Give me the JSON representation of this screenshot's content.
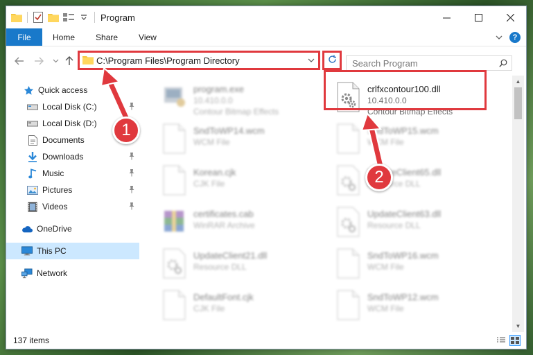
{
  "window": {
    "title": "Program",
    "accent_color": "#1979ca",
    "highlight_color": "#e0393e"
  },
  "ribbon": {
    "tabs": [
      "File",
      "Home",
      "Share",
      "View"
    ]
  },
  "address": {
    "path": "C:\\Program Files\\Program Directory",
    "search_placeholder": "Search Program"
  },
  "sidebar": {
    "items": [
      {
        "label": "Quick access",
        "icon": "star-icon",
        "pinned": false
      },
      {
        "label": "Local Disk (C:)",
        "icon": "drive-icon",
        "pinned": true
      },
      {
        "label": "Local Disk (D:)",
        "icon": "drive-icon",
        "pinned": true
      },
      {
        "label": "Documents",
        "icon": "documents-icon",
        "pinned": true
      },
      {
        "label": "Downloads",
        "icon": "download-icon",
        "pinned": true
      },
      {
        "label": "Music",
        "icon": "music-icon",
        "pinned": true
      },
      {
        "label": "Pictures",
        "icon": "pictures-icon",
        "pinned": true
      },
      {
        "label": "Videos",
        "icon": "videos-icon",
        "pinned": true
      },
      {
        "label": "OneDrive",
        "icon": "cloud-icon",
        "pinned": false
      },
      {
        "label": "This PC",
        "icon": "computer-icon",
        "pinned": false
      },
      {
        "label": "Network",
        "icon": "network-icon",
        "pinned": false
      }
    ]
  },
  "files": [
    {
      "name": "program.exe",
      "line1": "10.410.0.0",
      "line2": "Contour Bitmap Effects",
      "icon": "exe-icon"
    },
    {
      "name": "crlfxcontour100.dll",
      "line1": "10.410.0.0",
      "line2": "Contour Bitmap Effects",
      "icon": "dll-gear-icon"
    },
    {
      "name": "SndToWP14.wcm",
      "line1": "WCM File",
      "icon": "blank-file-icon"
    },
    {
      "name": "SndToWP15.wcm",
      "line1": "WCM File",
      "icon": "blank-file-icon"
    },
    {
      "name": "Korean.cjk",
      "line1": "CJK File",
      "icon": "blank-file-icon"
    },
    {
      "name": "UpdateClient65.dll",
      "line1": "Resource DLL",
      "icon": "dll-gear-icon"
    },
    {
      "name": "certificates.cab",
      "line1": "WinRAR Archive",
      "icon": "archive-icon"
    },
    {
      "name": "UpdateClient63.dll",
      "line1": "Resource DLL",
      "icon": "dll-gear-icon"
    },
    {
      "name": "UpdateClient21.dll",
      "line1": "Resource DLL",
      "icon": "dll-gear-icon"
    },
    {
      "name": "SndToWP16.wcm",
      "line1": "WCM File",
      "icon": "blank-file-icon"
    },
    {
      "name": "DefaultFont.cjk",
      "line1": "CJK File",
      "icon": "blank-file-icon"
    },
    {
      "name": "SndToWP12.wcm",
      "line1": "WCM File",
      "icon": "blank-file-icon"
    }
  ],
  "status": {
    "count": "137 items"
  },
  "callouts": [
    {
      "number": "1"
    },
    {
      "number": "2"
    }
  ]
}
